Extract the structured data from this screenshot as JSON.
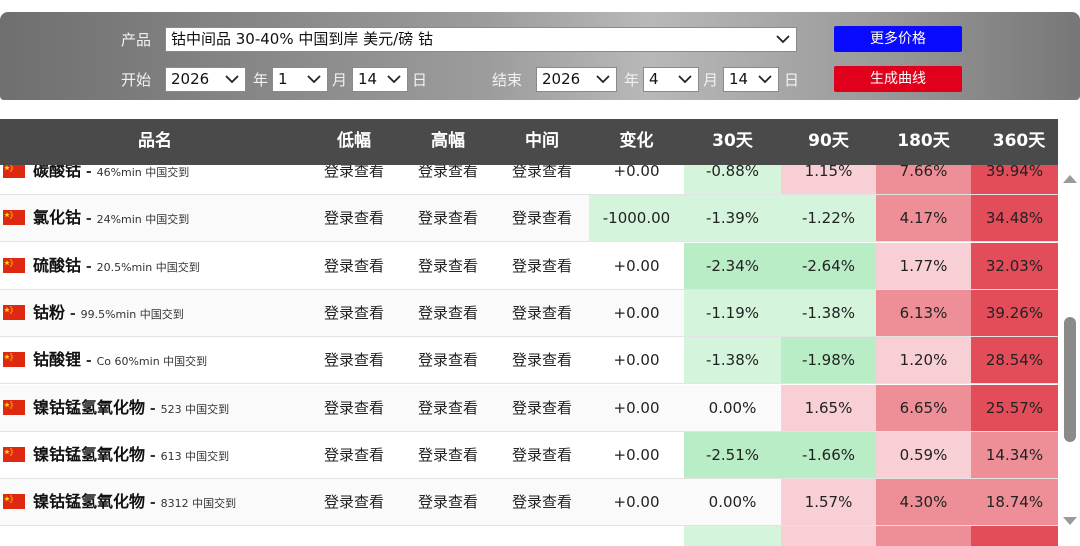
{
  "filters": {
    "product_label": "产品",
    "product_value": "钴中间品 30-40% 中国到岸 美元/磅 钴",
    "start_label": "开始",
    "end_label": "结束",
    "start": {
      "year": "2026",
      "month": "1",
      "day": "14"
    },
    "end": {
      "year": "2026",
      "month": "4",
      "day": "14"
    },
    "year_unit": "年",
    "month_unit": "月",
    "day_unit": "日",
    "more_prices_button": "更多价格",
    "generate_curve_button": "生成曲线"
  },
  "table": {
    "columns": [
      "品名",
      "低幅",
      "高幅",
      "中间",
      "变化",
      "30天",
      "90天",
      "180天",
      "360天"
    ],
    "rows": [
      {
        "name": "碳酸钴",
        "spec": "46%min 中国交到",
        "low": "登录查看",
        "high": "登录查看",
        "mid": "登录查看",
        "change": "+0.00",
        "d30": "-0.88%",
        "d90": "1.15%",
        "d180": "7.66%",
        "d360": "39.94%"
      },
      {
        "name": "氯化钴",
        "spec": "24%min 中国交到",
        "low": "登录查看",
        "high": "登录查看",
        "mid": "登录查看",
        "change": "-1000.00",
        "d30": "-1.39%",
        "d90": "-1.22%",
        "d180": "4.17%",
        "d360": "34.48%"
      },
      {
        "name": "硫酸钴",
        "spec": "20.5%min 中国交到",
        "low": "登录查看",
        "high": "登录查看",
        "mid": "登录查看",
        "change": "+0.00",
        "d30": "-2.34%",
        "d90": "-2.64%",
        "d180": "1.77%",
        "d360": "32.03%"
      },
      {
        "name": "钴粉",
        "spec": "99.5%min 中国交到",
        "low": "登录查看",
        "high": "登录查看",
        "mid": "登录查看",
        "change": "+0.00",
        "d30": "-1.19%",
        "d90": "-1.38%",
        "d180": "6.13%",
        "d360": "39.26%"
      },
      {
        "name": "钴酸锂",
        "spec": "Co 60%min 中国交到",
        "low": "登录查看",
        "high": "登录查看",
        "mid": "登录查看",
        "change": "+0.00",
        "d30": "-1.38%",
        "d90": "-1.98%",
        "d180": "1.20%",
        "d360": "28.54%"
      },
      {
        "name": "镍钴锰氢氧化物",
        "spec": "523 中国交到",
        "low": "登录查看",
        "high": "登录查看",
        "mid": "登录查看",
        "change": "+0.00",
        "d30": "0.00%",
        "d90": "1.65%",
        "d180": "6.65%",
        "d360": "25.57%"
      },
      {
        "name": "镍钴锰氢氧化物",
        "spec": "613 中国交到",
        "low": "登录查看",
        "high": "登录查看",
        "mid": "登录查看",
        "change": "+0.00",
        "d30": "-2.51%",
        "d90": "-1.66%",
        "d180": "0.59%",
        "d360": "14.34%"
      },
      {
        "name": "镍钴锰氢氧化物",
        "spec": "8312 中国交到",
        "low": "登录查看",
        "high": "登录查看",
        "mid": "登录查看",
        "change": "+0.00",
        "d30": "0.00%",
        "d90": "1.57%",
        "d180": "4.30%",
        "d360": "18.74%"
      },
      {
        "name": "",
        "spec": "",
        "low": "",
        "high": "",
        "mid": "",
        "change": "",
        "d30": "",
        "d90": "",
        "d180": "",
        "d360": ""
      }
    ]
  },
  "colors": {
    "header_bg": "#4a4a4a",
    "button_blue": "#0a0aff",
    "button_red": "#e0001b",
    "negative_light": "#d4f5dc",
    "negative_strong": "#b9edc6",
    "positive_light": "#f8cfd4",
    "positive_mid": "#ee8f98",
    "positive_strong": "#e24d59"
  }
}
